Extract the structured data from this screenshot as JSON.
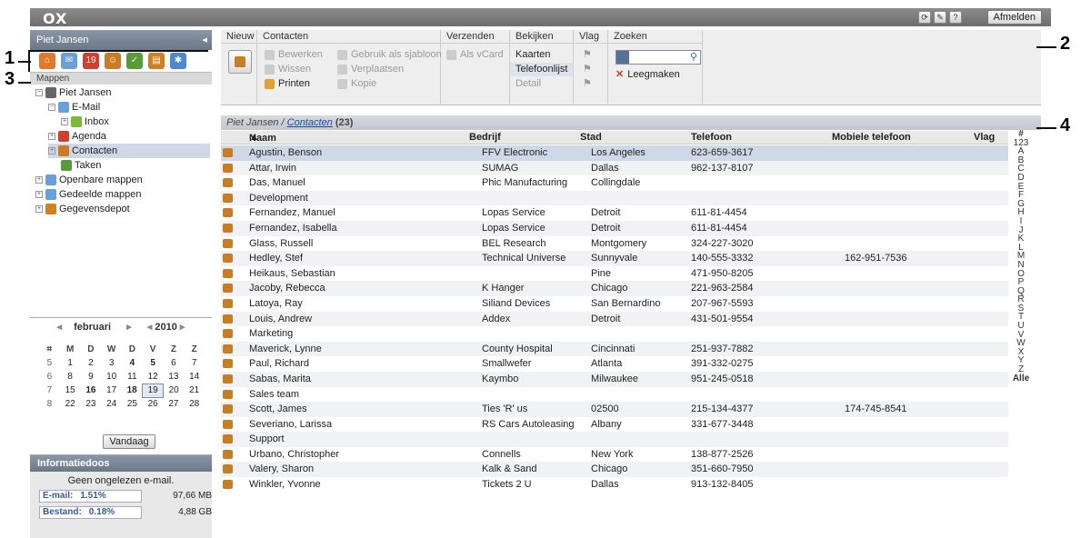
{
  "app": {
    "logo": "OX",
    "logout": "Afmelden",
    "user": "Piet Jansen"
  },
  "tree": {
    "title": "Mappen",
    "items": [
      {
        "label": "Piet Jansen"
      },
      {
        "label": "E-Mail"
      },
      {
        "label": "Inbox"
      },
      {
        "label": "Agenda"
      },
      {
        "label": "Contacten"
      },
      {
        "label": "Taken"
      },
      {
        "label": "Openbare mappen"
      },
      {
        "label": "Gedeelde mappen"
      },
      {
        "label": "Gegevensdepot"
      }
    ]
  },
  "calendar": {
    "month": "februari",
    "year": "2010",
    "weekdays": [
      "M",
      "D",
      "W",
      "D",
      "V",
      "Z",
      "Z"
    ],
    "weeks": [
      {
        "wk": "5",
        "days": [
          "1",
          "2",
          "3",
          "4",
          "5",
          "6",
          "7"
        ]
      },
      {
        "wk": "6",
        "days": [
          "8",
          "9",
          "10",
          "11",
          "12",
          "13",
          "14"
        ]
      },
      {
        "wk": "7",
        "days": [
          "15",
          "16",
          "17",
          "18",
          "19",
          "20",
          "21"
        ]
      },
      {
        "wk": "8",
        "days": [
          "22",
          "23",
          "24",
          "25",
          "26",
          "27",
          "28"
        ]
      }
    ],
    "today_label": "Vandaag"
  },
  "infobox": {
    "title": "Informatiedoos",
    "note": "Geen ongelezen e-mail.",
    "email": {
      "label": "E-mail:",
      "percent": "1.51%",
      "size": "97,66 MB"
    },
    "storage": {
      "label": "Bestand:",
      "percent": "0.18%",
      "size": "4,88 GB"
    }
  },
  "toolbar": {
    "new": "Nieuw",
    "contacts": {
      "title": "Contacten",
      "edit": "Bewerken",
      "template": "Gebruik als sjabloon",
      "delete": "Wissen",
      "move": "Verplaatsen",
      "print": "Printen",
      "copy": "Kopie"
    },
    "send": {
      "title": "Verzenden",
      "vcard": "Als vCard"
    },
    "view": {
      "title": "Bekijken",
      "cards": "Kaarten",
      "phonelist": "Telefoonlijst",
      "detail": "Detail"
    },
    "flag": {
      "title": "Vlag"
    },
    "search": {
      "title": "Zoeken",
      "clear": "Leegmaken"
    }
  },
  "list": {
    "path_user": "Piet Jansen",
    "path_folder": "Contacten",
    "count": "(23)",
    "columns": {
      "name": "Naam",
      "company": "Bedrijf",
      "city": "Stad",
      "phone": "Telefoon",
      "mobile": "Mobiele telefoon",
      "flag": "Vlag"
    },
    "rows": [
      {
        "name": "Agustin, Benson",
        "company": "FFV Electronic",
        "city": "Los Angeles",
        "phone": "623-659-3617",
        "mobile": ""
      },
      {
        "name": "Attar, Irwin",
        "company": "SUMAG",
        "city": "Dallas",
        "phone": "962-137-8107",
        "mobile": ""
      },
      {
        "name": "Das, Manuel",
        "company": "Phic Manufacturing",
        "city": "Collingdale",
        "phone": "",
        "mobile": ""
      },
      {
        "name": "Development",
        "company": "",
        "city": "",
        "phone": "",
        "mobile": ""
      },
      {
        "name": "Fernandez, Manuel",
        "company": "Lopas Service",
        "city": "Detroit",
        "phone": "611-81-4454",
        "mobile": ""
      },
      {
        "name": "Fernandez, Isabella",
        "company": "Lopas Service",
        "city": "Detroit",
        "phone": "611-81-4454",
        "mobile": ""
      },
      {
        "name": "Glass, Russell",
        "company": "BEL Research",
        "city": "Montgomery",
        "phone": "324-227-3020",
        "mobile": ""
      },
      {
        "name": "Hedley, Stef",
        "company": "Technical Universe",
        "city": "Sunnyvale",
        "phone": "140-555-3332",
        "mobile": "162-951-7536"
      },
      {
        "name": "Heikaus, Sebastian",
        "company": "",
        "city": "Pine",
        "phone": "471-950-8205",
        "mobile": ""
      },
      {
        "name": "Jacoby, Rebecca",
        "company": "K Hanger",
        "city": "Chicago",
        "phone": "221-963-2584",
        "mobile": ""
      },
      {
        "name": "Latoya, Ray",
        "company": "Siliand Devices",
        "city": "San Bernardino",
        "phone": "207-967-5593",
        "mobile": ""
      },
      {
        "name": "Louis, Andrew",
        "company": "Addex",
        "city": "Detroit",
        "phone": "431-501-9554",
        "mobile": ""
      },
      {
        "name": "Marketing",
        "company": "",
        "city": "",
        "phone": "",
        "mobile": ""
      },
      {
        "name": "Maverick, Lynne",
        "company": "County Hospital",
        "city": "Cincinnati",
        "phone": "251-937-7882",
        "mobile": ""
      },
      {
        "name": "Paul, Richard",
        "company": "Smallwefer",
        "city": "Atlanta",
        "phone": "391-332-0275",
        "mobile": ""
      },
      {
        "name": "Sabas, Marita",
        "company": "Kaymbo",
        "city": "Milwaukee",
        "phone": "951-245-0518",
        "mobile": ""
      },
      {
        "name": "Sales team",
        "company": "",
        "city": "",
        "phone": "",
        "mobile": ""
      },
      {
        "name": "Scott, James",
        "company": "Ties 'R' us",
        "city": "02500",
        "phone": "215-134-4377",
        "mobile": "174-745-8541"
      },
      {
        "name": "Severiano, Larissa",
        "company": "RS Cars Autoleasing",
        "city": "Albany",
        "phone": "331-677-3448",
        "mobile": ""
      },
      {
        "name": "Support",
        "company": "",
        "city": "",
        "phone": "",
        "mobile": ""
      },
      {
        "name": "Urbano, Christopher",
        "company": "Connells",
        "city": "New York",
        "phone": "138-877-2526",
        "mobile": ""
      },
      {
        "name": "Valery, Sharon",
        "company": "Kalk & Sand",
        "city": "Chicago",
        "phone": "351-660-7950",
        "mobile": ""
      },
      {
        "name": "Winkler, Yvonne",
        "company": "Tickets 2 U",
        "city": "Dallas",
        "phone": "913-132-8405",
        "mobile": ""
      }
    ]
  },
  "alphabet": [
    "#",
    "123",
    "A",
    "B",
    "C",
    "D",
    "E",
    "F",
    "G",
    "H",
    "I",
    "J",
    "K",
    "L",
    "M",
    "N",
    "O",
    "P",
    "Q",
    "R",
    "S",
    "T",
    "U",
    "V",
    "W",
    "X",
    "Y",
    "Z",
    "Alle"
  ],
  "callouts": [
    "1",
    "2",
    "3",
    "4"
  ]
}
